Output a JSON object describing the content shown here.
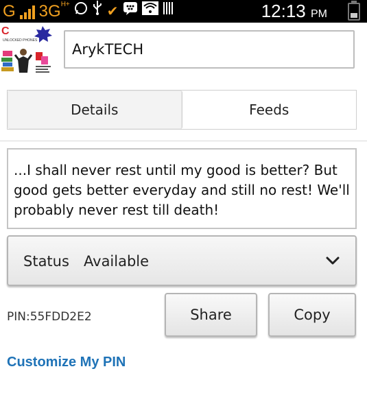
{
  "status_bar": {
    "network_type": "G",
    "data_type": "3G",
    "data_type_suffix": "H+",
    "time": "12:13",
    "ampm": "PM"
  },
  "profile": {
    "display_name": "ArykTECH",
    "avatar_text": "UNLOCKED PHONES"
  },
  "tabs": [
    {
      "label": "Details",
      "active": true
    },
    {
      "label": "Feeds",
      "active": false
    }
  ],
  "personal_message": "...I shall never rest until my good is better? But good gets better everyday and still no rest! We'll probably never rest till death!",
  "status": {
    "label": "Status",
    "value": "Available"
  },
  "pin": {
    "text": "PIN:55FDD2E2",
    "share_label": "Share",
    "copy_label": "Copy",
    "customize_label": "Customize My PIN"
  },
  "colors": {
    "accent_link": "#1f73b7",
    "statusbar_accent": "#f0a020"
  }
}
